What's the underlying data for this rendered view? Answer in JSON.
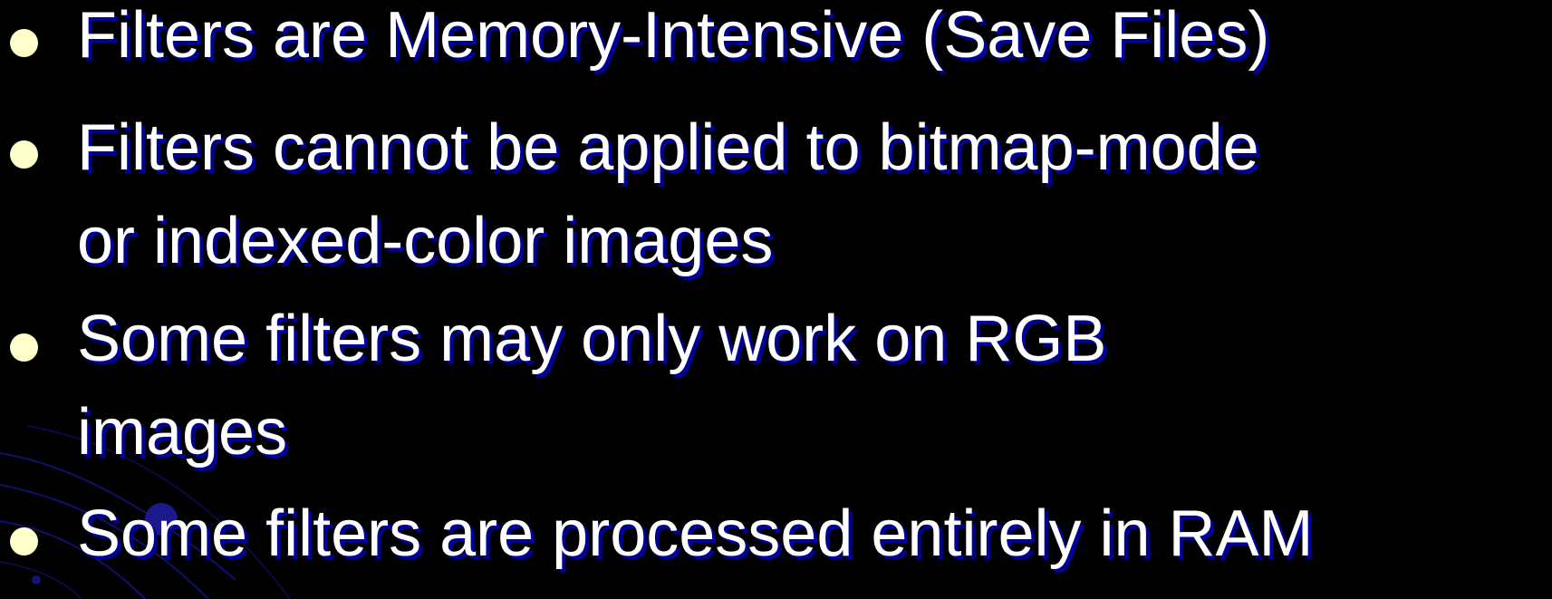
{
  "slide": {
    "bullets": [
      {
        "lines": [
          "Filters are Memory-Intensive (Save Files)"
        ]
      },
      {
        "lines": [
          "Filters cannot be applied to bitmap-mode",
          "or indexed-color images"
        ]
      },
      {
        "lines": [
          "Some filters may only work on RGB",
          "images"
        ]
      },
      {
        "lines": [
          "Some filters are processed entirely in RAM"
        ]
      }
    ]
  },
  "colors": {
    "background": "#000000",
    "text": "#ffffff",
    "text_shadow": "#000099",
    "bullet": "#ffffcc",
    "decor_lines": "#1a1a8c"
  }
}
